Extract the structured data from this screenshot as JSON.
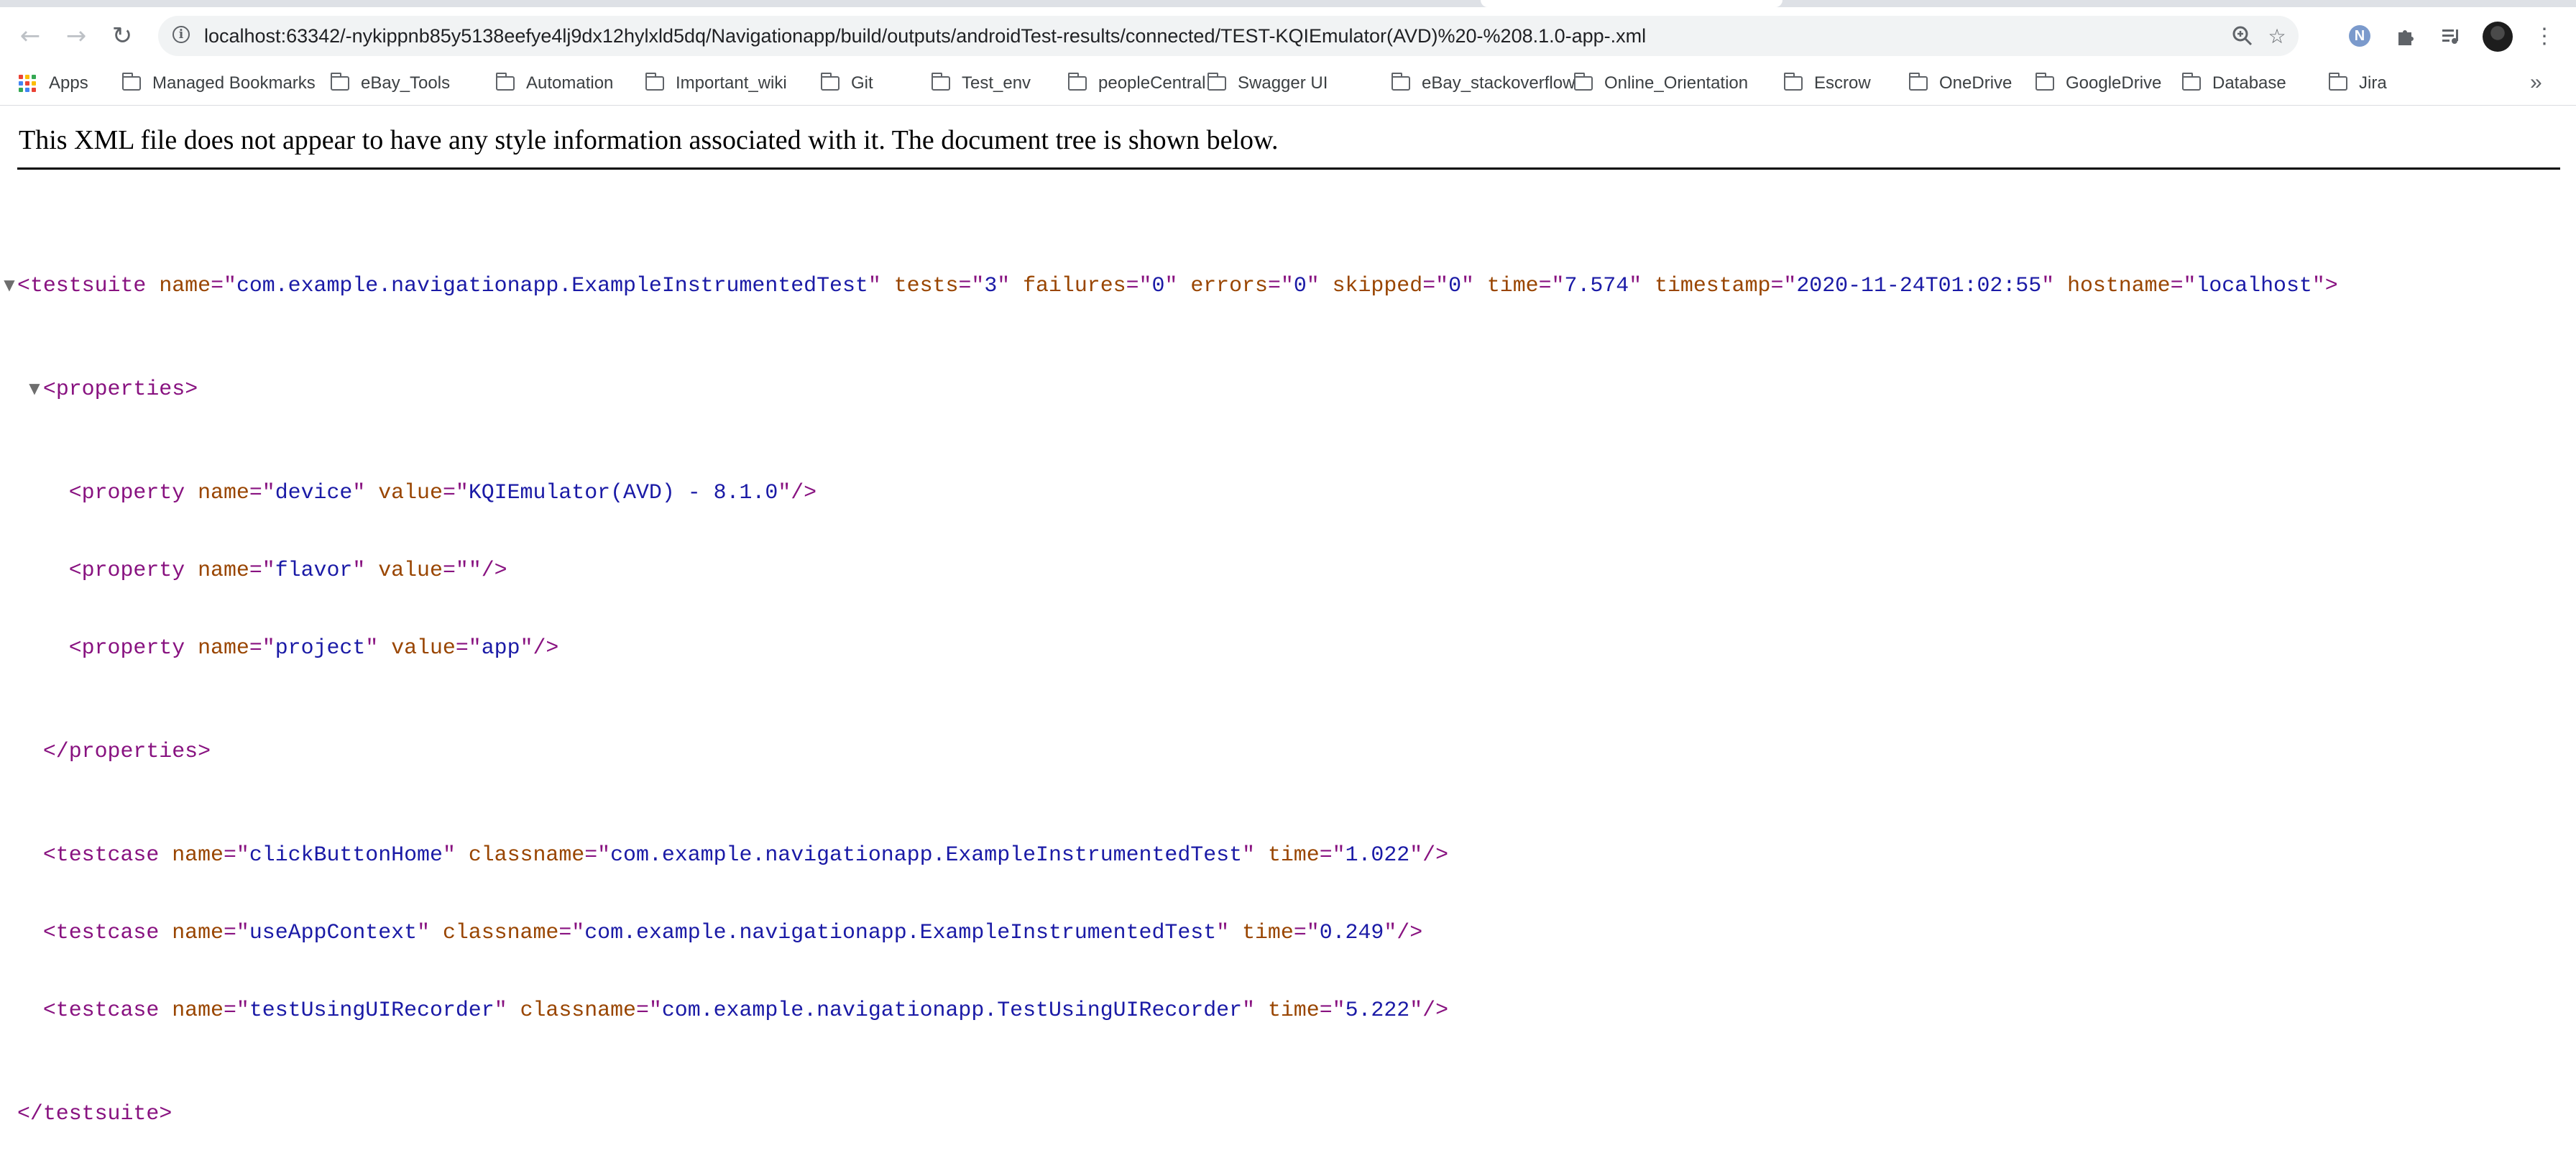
{
  "browser": {
    "url": "localhost:63342/-nykippnb85y5138eefye4lj9dx12hylxld5dq/Navigationapp/build/outputs/androidTest-results/connected/TEST-KQIEmulator(AVD)%20-%208.1.0-app-.xml",
    "extension_n_label": "N",
    "icons": {
      "back": "back-arrow-icon",
      "forward": "forward-arrow-icon",
      "reload": "reload-icon",
      "site_info": "info-icon",
      "zoom": "zoom-icon",
      "bookmark": "star-icon",
      "extensions": "puzzle-icon",
      "media": "media-queue-icon",
      "menu": "kebab-menu-icon"
    }
  },
  "bookmarks": {
    "apps_label": "Apps",
    "items": [
      "Managed Bookmarks",
      "eBay_Tools",
      "Automation",
      "Important_wiki",
      "Git",
      "Test_env",
      "peopleCentral",
      "Swagger UI",
      "eBay_stackoverflow",
      "Online_Orientation",
      "Escrow",
      "OneDrive",
      "GoogleDrive",
      "Database",
      "Jira"
    ],
    "overflow": "»"
  },
  "page": {
    "notice": "This XML file does not appear to have any style information associated with it. The document tree is shown below.",
    "xml": {
      "testsuite": {
        "tag": "testsuite",
        "name": "com.example.navigationapp.ExampleInstrumentedTest",
        "tests": "3",
        "failures": "0",
        "errors": "0",
        "skipped": "0",
        "time": "7.574",
        "timestamp": "2020-11-24T01:02:55",
        "hostname": "localhost"
      },
      "properties_tag": "properties",
      "properties": [
        {
          "name": "device",
          "value": "KQIEmulator(AVD) - 8.1.0"
        },
        {
          "name": "flavor",
          "value": ""
        },
        {
          "name": "project",
          "value": "app"
        }
      ],
      "testcases": [
        {
          "name": "clickButtonHome",
          "classname": "com.example.navigationapp.ExampleInstrumentedTest",
          "time": "1.022"
        },
        {
          "name": "useAppContext",
          "classname": "com.example.navigationapp.ExampleInstrumentedTest",
          "time": "0.249"
        },
        {
          "name": "testUsingUIRecorder",
          "classname": "com.example.navigationapp.TestUsingUIRecorder",
          "time": "5.222"
        }
      ]
    }
  },
  "colors": {
    "tag": "#881280",
    "attribute": "#994500",
    "value": "#1a1aa6",
    "apps_grid": [
      "#ea4335",
      "#fbbc04",
      "#34a853",
      "#4285f4",
      "#ea4335",
      "#fbbc04",
      "#34a853",
      "#4285f4",
      "#ea4335"
    ]
  }
}
